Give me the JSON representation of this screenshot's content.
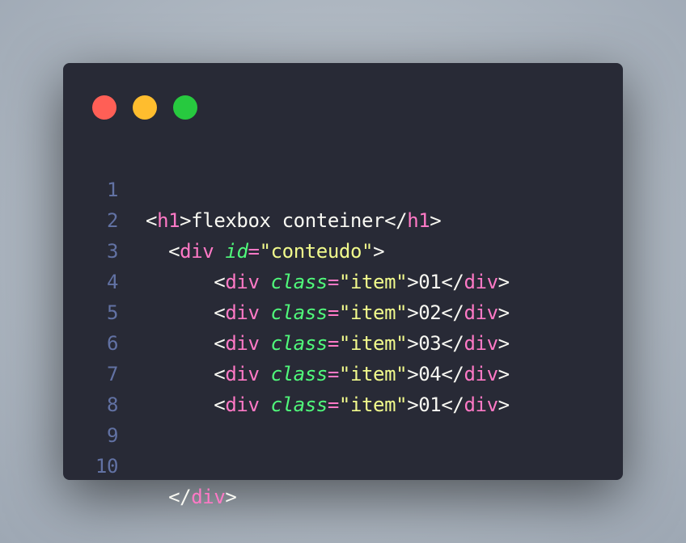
{
  "colors": {
    "background": "#aeb7c1",
    "window": "#282a36",
    "dot_red": "#ff5f56",
    "dot_yellow": "#ffbd2e",
    "dot_green": "#27c93f",
    "line_number": "#6272a4",
    "tag": "#ff79c6",
    "attribute": "#50fa7b",
    "string": "#f1fa8c",
    "text": "#f8f8f2"
  },
  "window_controls": {
    "close_icon": "red-circle",
    "minimize_icon": "yellow-circle",
    "maximize_icon": "green-circle"
  },
  "code": {
    "line_numbers": [
      "1",
      "2",
      "3",
      "4",
      "5",
      "6",
      "7",
      "8",
      "9",
      "10"
    ],
    "line1": {
      "open_lt": "<",
      "tag_open": "h1",
      "open_gt": ">",
      "content": "flexbox conteiner",
      "close_lt": "</",
      "tag_close": "h1",
      "close_gt": ">"
    },
    "line2": {
      "lt": "<",
      "tag": "div",
      "attr": "id",
      "eq": "=",
      "value": "\"conteudo\"",
      "gt": ">"
    },
    "items": [
      {
        "lt": "<",
        "tag": "div",
        "attr": "class",
        "eq": "=",
        "value": "\"item\"",
        "gt": ">",
        "content": "01",
        "close_lt": "</",
        "close_tag": "div",
        "close_gt": ">"
      },
      {
        "lt": "<",
        "tag": "div",
        "attr": "class",
        "eq": "=",
        "value": "\"item\"",
        "gt": ">",
        "content": "02",
        "close_lt": "</",
        "close_tag": "div",
        "close_gt": ">"
      },
      {
        "lt": "<",
        "tag": "div",
        "attr": "class",
        "eq": "=",
        "value": "\"item\"",
        "gt": ">",
        "content": "03",
        "close_lt": "</",
        "close_tag": "div",
        "close_gt": ">"
      },
      {
        "lt": "<",
        "tag": "div",
        "attr": "class",
        "eq": "=",
        "value": "\"item\"",
        "gt": ">",
        "content": "04",
        "close_lt": "</",
        "close_tag": "div",
        "close_gt": ">"
      },
      {
        "lt": "<",
        "tag": "div",
        "attr": "class",
        "eq": "=",
        "value": "\"item\"",
        "gt": ">",
        "content": "01",
        "close_lt": "</",
        "close_tag": "div",
        "close_gt": ">"
      }
    ],
    "line10": {
      "close_lt": "</",
      "tag": "div",
      "gt": ">"
    }
  }
}
